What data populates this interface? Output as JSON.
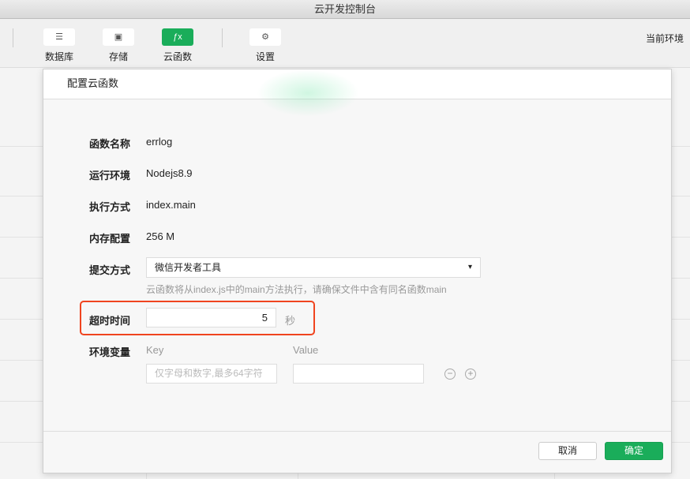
{
  "window": {
    "title": "云开发控制台"
  },
  "toolbar": {
    "items": [
      {
        "label": "数据库",
        "icon": "database-icon"
      },
      {
        "label": "存储",
        "icon": "storage-icon"
      },
      {
        "label": "云函数",
        "icon": "function-icon",
        "active": true
      },
      {
        "label": "设置",
        "icon": "gear-icon"
      }
    ],
    "env_label": "当前环境"
  },
  "dialog": {
    "title": "配置云函数",
    "fields": {
      "name": {
        "label": "函数名称",
        "value": "errlog"
      },
      "runtime": {
        "label": "运行环境",
        "value": "Nodejs8.9"
      },
      "handler": {
        "label": "执行方式",
        "value": "index.main"
      },
      "memory": {
        "label": "内存配置",
        "value": "256 M"
      },
      "submit": {
        "label": "提交方式",
        "value": "微信开发者工具",
        "hint": "云函数将从index.js中的main方法执行，请确保文件中含有同名函数main"
      },
      "timeout": {
        "label": "超时时间",
        "value": "5",
        "unit": "秒"
      },
      "env": {
        "label": "环境变量",
        "key_header": "Key",
        "value_header": "Value",
        "key_placeholder": "仅字母和数字,最多64字符",
        "value_value": ""
      }
    },
    "cancel": "取消",
    "confirm": "确定",
    "accent": "#1aad5a",
    "highlight": "#f0441f"
  }
}
